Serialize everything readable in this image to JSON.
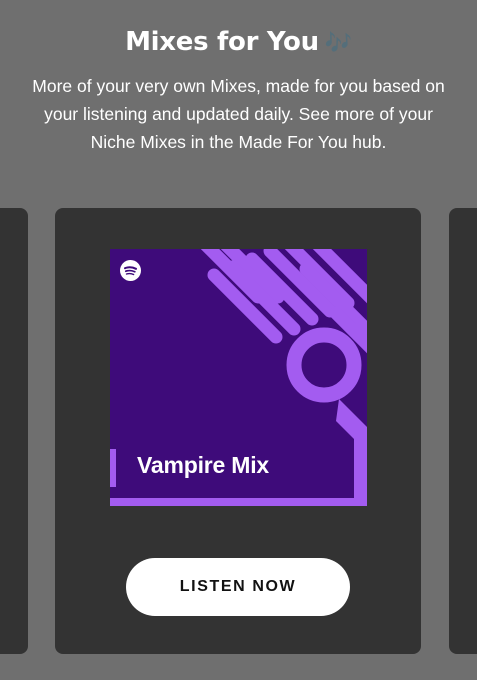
{
  "header": {
    "title": "Mixes for You",
    "title_emoji": "🎶",
    "description": "More of your very own Mixes, made for you based on your listening and updated daily. See more of your Niche Mixes in the Made For You hub."
  },
  "carousel": {
    "active_card": {
      "cover": {
        "title": "Vampire Mix",
        "logo_icon": "spotify-icon",
        "background_color": "#3e0b7a",
        "accent_color": "#a35cf0"
      },
      "button_label": "LISTEN NOW"
    }
  },
  "colors": {
    "page_background": "#6f6f6f",
    "card_background": "#333333",
    "button_background": "#ffffff"
  }
}
